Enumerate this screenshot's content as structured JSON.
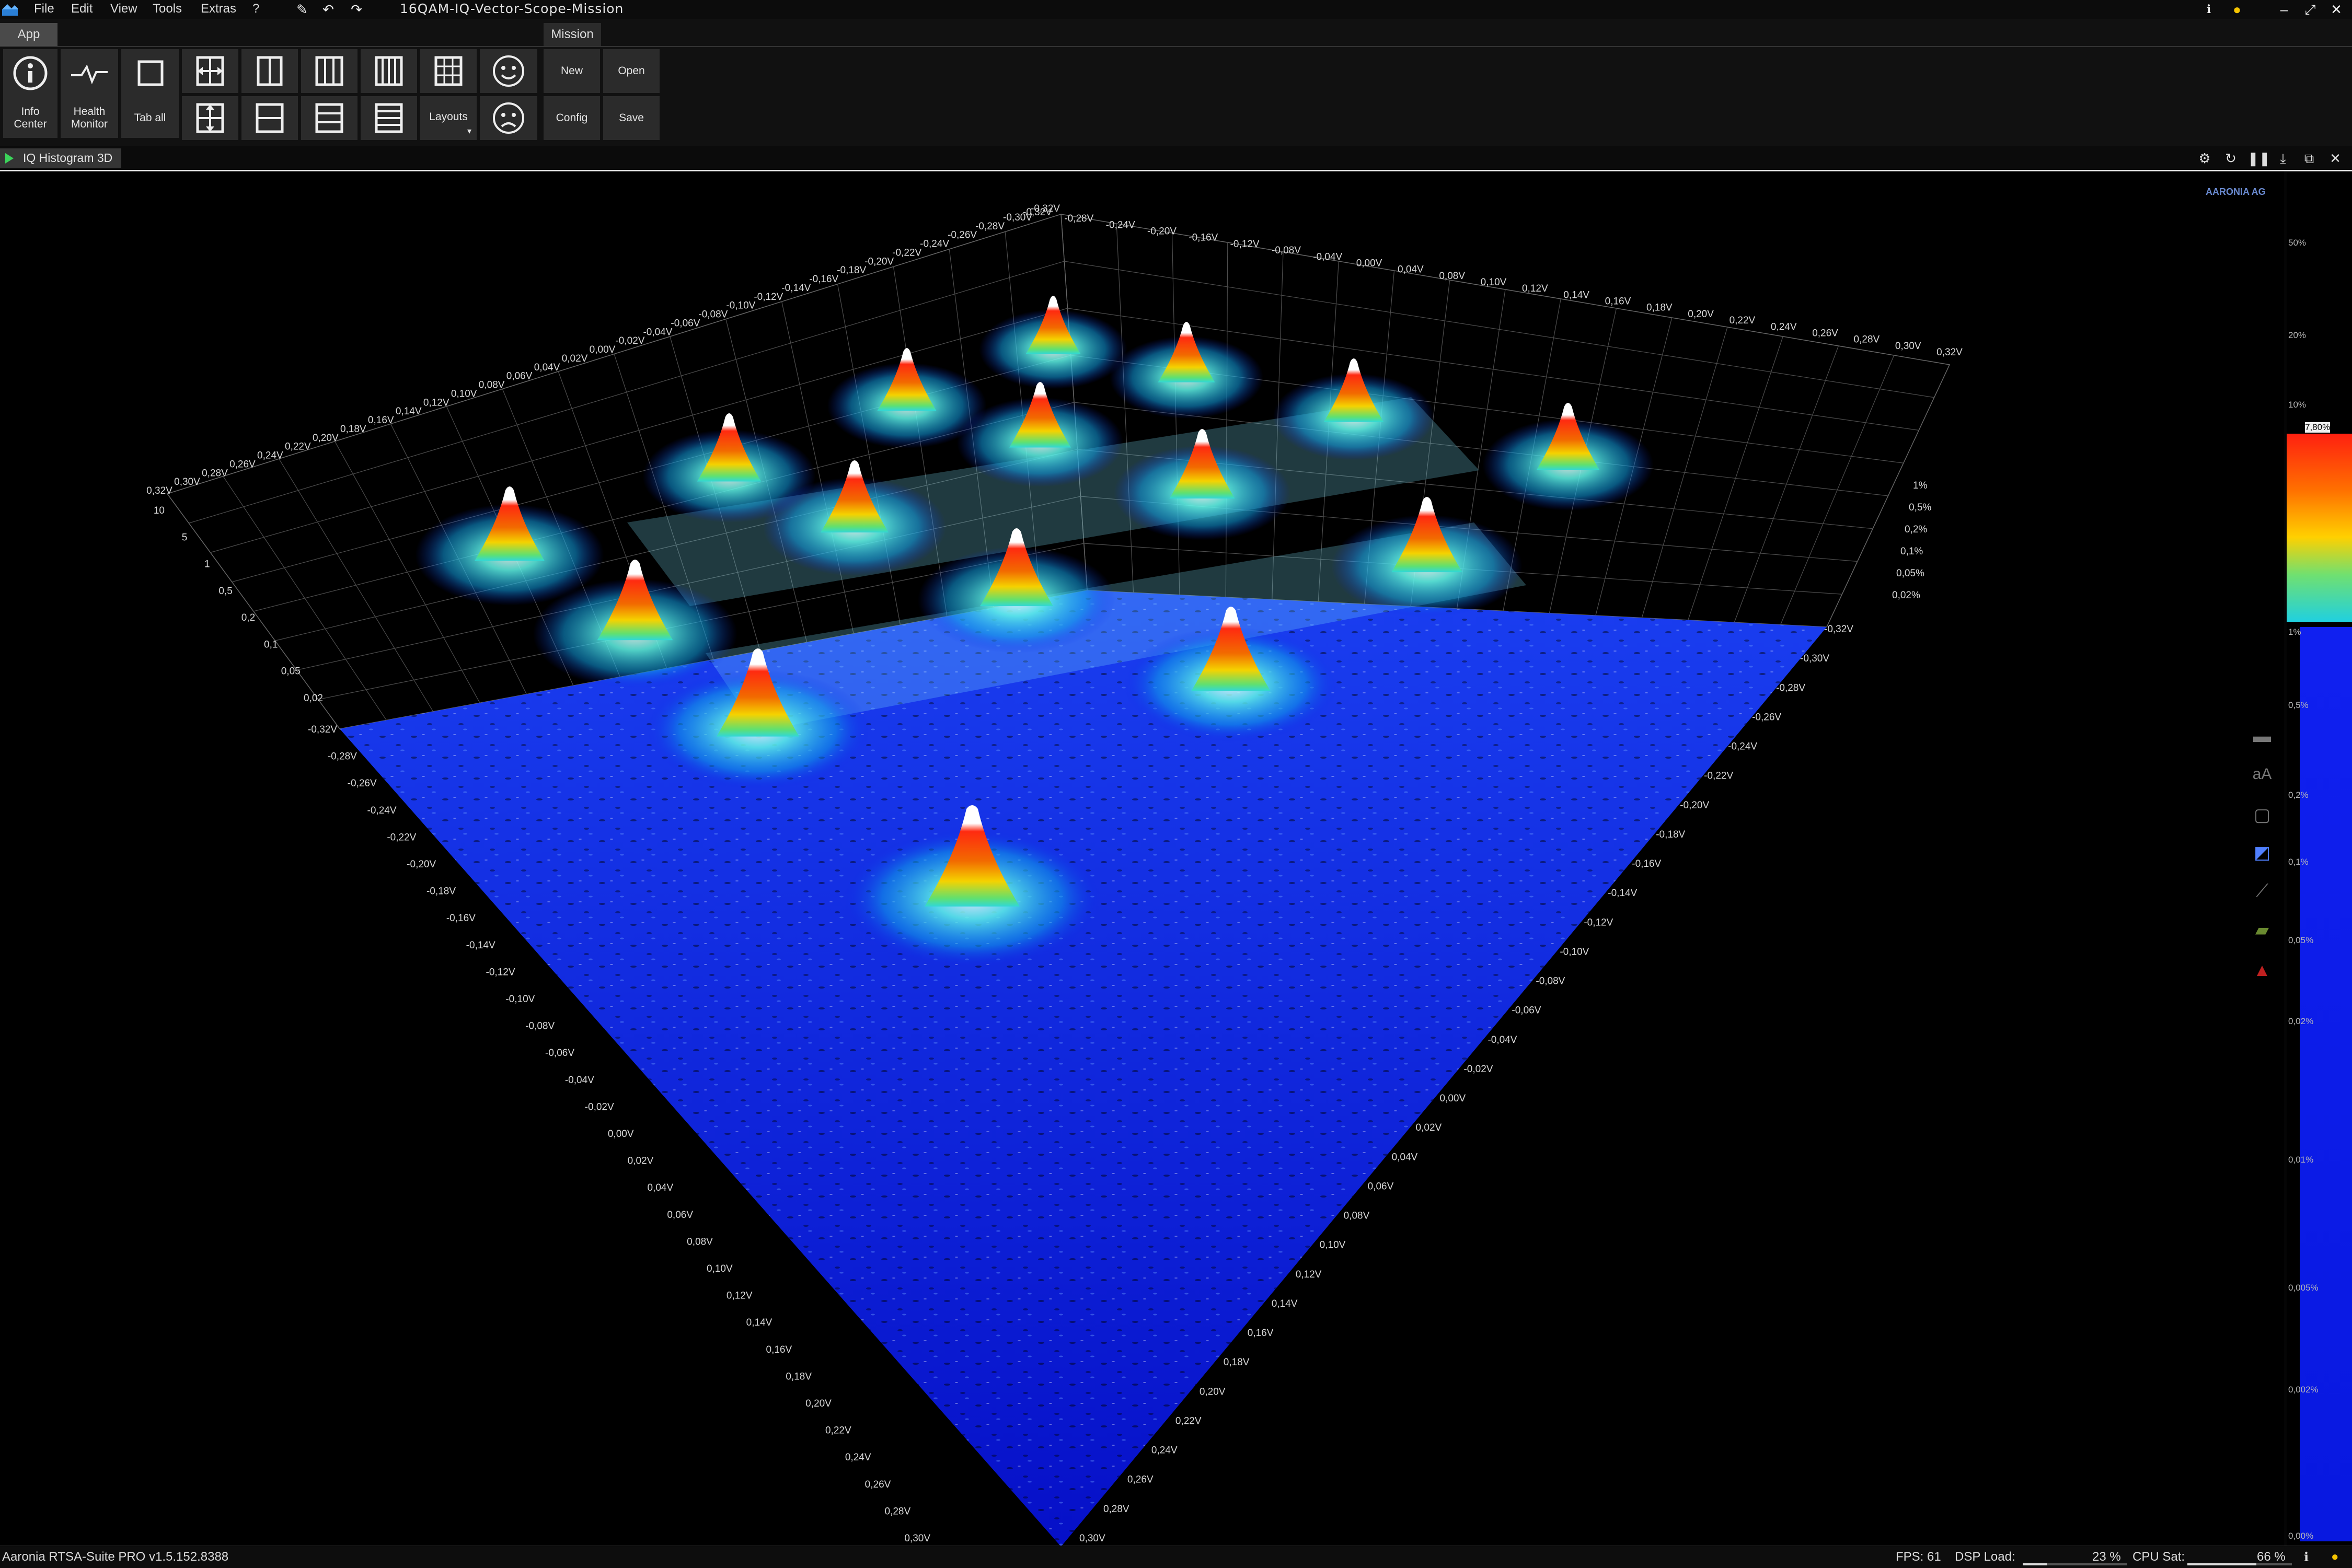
{
  "window": {
    "title": "16QAM-IQ-Vector-Scope-Mission",
    "menu": [
      "File",
      "Edit",
      "View",
      "Tools",
      "Extras",
      "?"
    ]
  },
  "ribbon": {
    "tabs": [
      "App",
      "Mission"
    ],
    "info_center": "Info Center",
    "health_monitor": "Health Monitor",
    "tab_all": "Tab all",
    "layouts": "Layouts",
    "new": "New",
    "open": "Open",
    "config": "Config",
    "save": "Save"
  },
  "view": {
    "tab_label": "IQ Histogram 3D"
  },
  "plot": {
    "back_left_i_labels": [
      "0,32V",
      "0,30V",
      "0,28V",
      "0,26V",
      "0,24V",
      "0,22V",
      "0,20V",
      "0,18V",
      "0,16V",
      "0,14V",
      "0,12V",
      "0,10V",
      "0,08V",
      "0,06V",
      "0,04V",
      "0,02V",
      "0,00V",
      "-0,02V",
      "-0,04V",
      "-0,06V",
      "-0,08V",
      "-0,10V",
      "-0,12V",
      "-0,14V",
      "-0,16V",
      "-0,18V",
      "-0,20V",
      "-0,22V",
      "-0,24V",
      "-0,26V",
      "-0,28V",
      "-0,30V",
      "-0,32V"
    ],
    "back_right_q_labels": [
      "-0,32V",
      "-0,28V",
      "-0,24V",
      "-0,20V",
      "-0,16V",
      "-0,12V",
      "-0,08V",
      "-0,04V",
      "0,00V",
      "0,04V",
      "0,08V",
      "0,10V",
      "0,12V",
      "0,14V",
      "0,16V",
      "0,18V",
      "0,20V",
      "0,22V",
      "0,24V",
      "0,26V",
      "0,28V",
      "0,30V",
      "0,32V"
    ],
    "left_height_labels": [
      "10",
      "5",
      "1",
      "0,5",
      "0,2",
      "0,1",
      "0,05",
      "0,02"
    ],
    "right_height_labels": [
      "1%",
      "0,5%",
      "0,2%",
      "0,1%",
      "0,05%",
      "0,02%"
    ],
    "front_left_labels": [
      "-0,32V",
      "-0,28V",
      "-0,26V",
      "-0,24V",
      "-0,22V",
      "-0,20V",
      "-0,18V",
      "-0,16V",
      "-0,14V",
      "-0,12V",
      "-0,10V",
      "-0,08V",
      "-0,06V",
      "-0,04V",
      "-0,02V",
      "0,00V",
      "0,02V",
      "0,04V",
      "0,06V",
      "0,08V",
      "0,10V",
      "0,12V",
      "0,14V",
      "0,16V",
      "0,18V",
      "0,20V",
      "0,22V",
      "0,24V",
      "0,26V",
      "0,28V",
      "0,30V"
    ],
    "front_right_labels": [
      "-0,32V",
      "-0,30V",
      "-0,28V",
      "-0,26V",
      "-0,24V",
      "-0,22V",
      "-0,20V",
      "-0,18V",
      "-0,16V",
      "-0,14V",
      "-0,12V",
      "-0,10V",
      "-0,08V",
      "-0,06V",
      "-0,04V",
      "-0,02V",
      "0,00V",
      "0,02V",
      "0,04V",
      "0,06V",
      "0,08V",
      "0,10V",
      "0,12V",
      "0,14V",
      "0,16V",
      "0,18V",
      "0,20V",
      "0,22V",
      "0,24V",
      "0,26V",
      "0,28V",
      "0,30V"
    ],
    "colors": {
      "base": "#0a12e0",
      "mid": "#12e0e8",
      "peak_red": "#e01010",
      "peak_yellow": "#f0c800",
      "cap": "#ffffff"
    }
  },
  "right_panel": {
    "scale_labels": [
      "50%",
      "20%",
      "10%",
      "7,80%",
      "1%",
      "0,5%",
      "0,2%",
      "0,1%",
      "0,05%",
      "0,02%",
      "0,01%",
      "0,005%",
      "0,002%",
      "0,00%"
    ],
    "logo": "AARONIA AG"
  },
  "status": {
    "version": "Aaronia RTSA-Suite PRO v1.5.152.8388",
    "fps": "FPS: 61",
    "dsp_load_label": "DSP Load:",
    "dsp_load_value": "23 %",
    "dsp_load_level": 23,
    "cpu_sat_label": "CPU Sat:",
    "cpu_sat_value": "66 %",
    "cpu_sat_level": 66
  }
}
